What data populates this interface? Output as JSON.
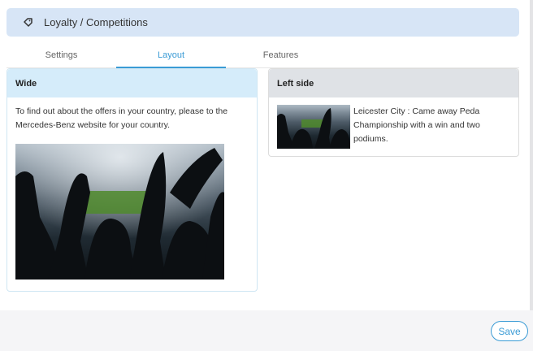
{
  "breadcrumb": {
    "icon": "tag-icon",
    "title": "Loyalty / Competitions"
  },
  "tabs": [
    {
      "label": "Settings",
      "active": false
    },
    {
      "label": "Layout",
      "active": true
    },
    {
      "label": "Features",
      "active": false
    }
  ],
  "wide_card": {
    "heading": "Wide",
    "text": "To find out about the offers in your country, please to the Mercedes-Benz website for your country.",
    "image": "stadium-crowd-photo"
  },
  "left_card": {
    "heading": "Left side",
    "image": "stadium-crowd-thumbnail",
    "article_text": "Leicester City : Came away Peda Championship with a win and two podiums."
  },
  "footer": {
    "save_label": "Save"
  },
  "colors": {
    "accent": "#3a9bd5",
    "breadcrumb_bg": "#d7e5f6",
    "wide_header_bg": "#d5ecfa",
    "left_header_bg": "#dfe2e6"
  }
}
